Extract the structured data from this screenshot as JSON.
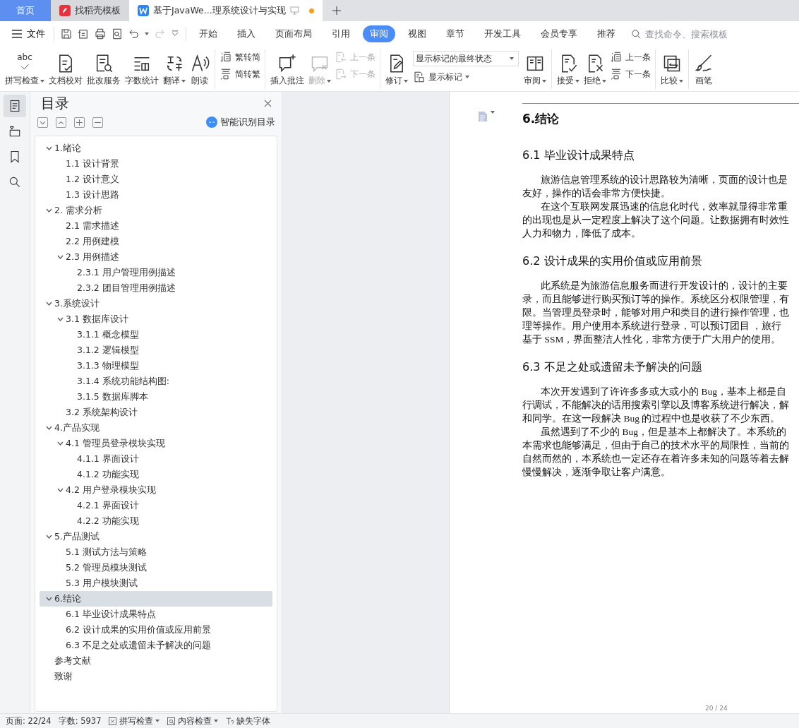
{
  "window_tabs": [
    {
      "kind": "home",
      "label": "首页",
      "selected": false
    },
    {
      "kind": "web",
      "label": "找稻壳模板",
      "selected": false
    },
    {
      "kind": "doc",
      "label": "基于JavaWe...理系统设计与实现",
      "selected": true,
      "unsaved": true
    }
  ],
  "toolbar": {
    "file_menu": "文件",
    "ribbon_tabs": [
      {
        "label": "开始",
        "selected": false
      },
      {
        "label": "插入",
        "selected": false
      },
      {
        "label": "页面布局",
        "selected": false
      },
      {
        "label": "引用",
        "selected": false
      },
      {
        "label": "审阅",
        "selected": true
      },
      {
        "label": "视图",
        "selected": false
      },
      {
        "label": "章节",
        "selected": false
      },
      {
        "label": "开发工具",
        "selected": false
      },
      {
        "label": "会员专享",
        "selected": false
      },
      {
        "label": "推荐",
        "selected": false
      }
    ],
    "search": {
      "placeholder": "查找命令、搜索模板"
    }
  },
  "ribbon": [
    {
      "kind": "big",
      "label": "拼写检查",
      "glyph": "abc",
      "dropdown": true,
      "disabled": false
    },
    {
      "kind": "big",
      "label": "文档校对",
      "dropdown": false,
      "disabled": false
    },
    {
      "kind": "big",
      "label": "批改服务",
      "dropdown": false,
      "disabled": false
    },
    {
      "kind": "big",
      "label": "字数统计",
      "dropdown": false,
      "disabled": false
    },
    {
      "kind": "big",
      "label": "翻译",
      "dropdown": true,
      "disabled": false
    },
    {
      "kind": "big",
      "label": "朗读",
      "dropdown": false,
      "disabled": false
    },
    {
      "kind": "divider"
    },
    {
      "kind": "pair",
      "items": [
        {
          "label": "繁转简",
          "disabled": false
        },
        {
          "label": "简转繁",
          "disabled": false
        }
      ]
    },
    {
      "kind": "divider"
    },
    {
      "kind": "big",
      "label": "插入批注",
      "dropdown": false,
      "disabled": false
    },
    {
      "kind": "big",
      "label": "删除",
      "dropdown": true,
      "disabled": true
    },
    {
      "kind": "pair",
      "items": [
        {
          "label": "上一条",
          "disabled": true
        },
        {
          "label": "下一条",
          "disabled": true
        }
      ]
    },
    {
      "kind": "divider"
    },
    {
      "kind": "big",
      "label": "修订",
      "dropdown": true,
      "disabled": false
    },
    {
      "kind": "select",
      "value": "显示标记的最终状态",
      "sub_label": "显示标记"
    },
    {
      "kind": "big",
      "label": "审阅",
      "dropdown": true,
      "disabled": false
    },
    {
      "kind": "divider"
    },
    {
      "kind": "big",
      "label": "接受",
      "dropdown": true,
      "disabled": false
    },
    {
      "kind": "big",
      "label": "拒绝",
      "dropdown": true,
      "disabled": false
    },
    {
      "kind": "pair",
      "items": [
        {
          "label": "上一条",
          "disabled": false
        },
        {
          "label": "下一条",
          "disabled": false
        }
      ]
    },
    {
      "kind": "divider"
    },
    {
      "kind": "big",
      "label": "比较",
      "dropdown": true,
      "disabled": false
    },
    {
      "kind": "divider"
    },
    {
      "kind": "big",
      "label": "画笔",
      "dropdown": false,
      "disabled": false
    }
  ],
  "side_strip": [
    {
      "selected": true
    },
    {
      "selected": false
    },
    {
      "selected": false
    },
    {
      "selected": false
    }
  ],
  "toc": {
    "title": "目录",
    "smart_label": "智能识别目录",
    "items": [
      {
        "label": "1.绪论",
        "selected": false,
        "expanded": true,
        "children": [
          {
            "label": "1.1 设计背景",
            "selected": false
          },
          {
            "label": "1.2 设计意义",
            "selected": false
          },
          {
            "label": "1.3 设计思路",
            "selected": false
          }
        ]
      },
      {
        "label": "2.  需求分析",
        "selected": false,
        "expanded": true,
        "children": [
          {
            "label": "2.1  需求描述",
            "selected": false
          },
          {
            "label": "2.2  用例建模",
            "selected": false
          },
          {
            "label": "2.3  用例描述",
            "selected": false,
            "expanded": true,
            "children": [
              {
                "label": "2.3.1  用户管理用例描述",
                "selected": false
              },
              {
                "label": "2.3.2  团目管理用例描述",
                "selected": false
              }
            ]
          }
        ]
      },
      {
        "label": "3.系统设计",
        "selected": false,
        "expanded": true,
        "children": [
          {
            "label": "3.1  数据库设计",
            "selected": false,
            "expanded": true,
            "children": [
              {
                "label": "3.1.1  概念模型",
                "selected": false
              },
              {
                "label": "3.1.2  逻辑模型",
                "selected": false
              },
              {
                "label": "3.1.3  物理模型",
                "selected": false
              },
              {
                "label": "3.1.4  系统功能结构图:",
                "selected": false
              },
              {
                "label": "3.1.5  数据库脚本",
                "selected": false
              }
            ]
          },
          {
            "label": "3.2  系统架构设计",
            "selected": false
          }
        ]
      },
      {
        "label": "4.产品实现",
        "selected": false,
        "expanded": true,
        "children": [
          {
            "label": "4.1  管理员登录模块实现",
            "selected": false,
            "expanded": true,
            "children": [
              {
                "label": "4.1.1  界面设计",
                "selected": false
              },
              {
                "label": "4.1.2  功能实现",
                "selected": false
              }
            ]
          },
          {
            "label": "4.2  用户登录模块实现",
            "selected": false,
            "expanded": true,
            "children": [
              {
                "label": "4.2.1  界面设计",
                "selected": false
              },
              {
                "label": "4.2.2  功能实现",
                "selected": false
              }
            ]
          }
        ]
      },
      {
        "label": "5.产品测试",
        "selected": false,
        "expanded": true,
        "children": [
          {
            "label": "5.1  测试方法与策略",
            "selected": false
          },
          {
            "label": "5.2 管理员模块测试",
            "selected": false
          },
          {
            "label": "5.3  用户模块测试",
            "selected": false
          }
        ]
      },
      {
        "label": "6.结论",
        "selected": true,
        "expanded": true,
        "children": [
          {
            "label": "6.1 毕业设计成果特点",
            "selected": false
          },
          {
            "label": "6.2 设计成果的实用价值或应用前景",
            "selected": false
          },
          {
            "label": "6.3 不足之处或遗留未予解决的问题",
            "selected": false
          }
        ]
      },
      {
        "label": "参考文献",
        "selected": false
      },
      {
        "label": "致谢",
        "selected": false
      }
    ]
  },
  "document": {
    "page_number": "20 / 24",
    "blocks": [
      {
        "kind": "h1",
        "text": "6.结论"
      },
      {
        "kind": "h2",
        "text": "6.1 毕业设计成果特点"
      },
      {
        "kind": "para",
        "lines": [
          "旅游信息管理系统的设计思路较为清晰，页面的设计也是",
          "友好，操作的话会非常方便快捷。"
        ]
      },
      {
        "kind": "para",
        "lines": [
          "在这个互联网发展迅速的信息化时代，效率就显得非常重",
          "的出现也是从一定程度上解决了这个问题。让数据拥有时效性",
          "人力和物力，降低了成本。"
        ]
      },
      {
        "kind": "h2",
        "text": "6.2 设计成果的实用价值或应用前景"
      },
      {
        "kind": "para",
        "lines": [
          "此系统是为旅游信息服务而进行开发设计的，设计的主要",
          "录，而且能够进行购买预订等的操作。系统区分权限管理，有",
          "限。当管理员登录时，能够对用户和类目的进行操作管理，也",
          "理等操作。用户使用本系统进行登录，可以预订团目 ，旅行",
          "基于 SSM，界面整洁人性化，非常方便于广大用户的使用。"
        ]
      },
      {
        "kind": "h2",
        "text": "6.3 不足之处或遗留未予解决的问题"
      },
      {
        "kind": "para",
        "lines": [
          "本次开发遇到了许许多多或大或小的 Bug，基本上都是自",
          "行调试，不能解决的话用搜索引擎以及博客系统进行解决，解",
          "和同学。在这一段解决 Bug 的过程中也是收获了不少东西。"
        ]
      },
      {
        "kind": "para",
        "lines": [
          "虽然遇到了不少的 Bug，但是基本上都解决了。本系统的",
          "本需求也能够满足，但由于自己的技术水平的局限性，当前的",
          "自然而然的，本系统也一定还存在着许多未知的问题等着去解",
          "慢慢解决，逐渐争取让客户满意。"
        ]
      }
    ]
  },
  "status_bar": [
    {
      "kind": "text",
      "label": "页面: 22/24"
    },
    {
      "kind": "text",
      "label": "字数: 5937"
    },
    {
      "kind": "check",
      "label": "拼写检查",
      "dropdown": true
    },
    {
      "kind": "content",
      "label": "内容检查",
      "dropdown": true
    },
    {
      "kind": "font",
      "label": "缺失字体"
    }
  ]
}
